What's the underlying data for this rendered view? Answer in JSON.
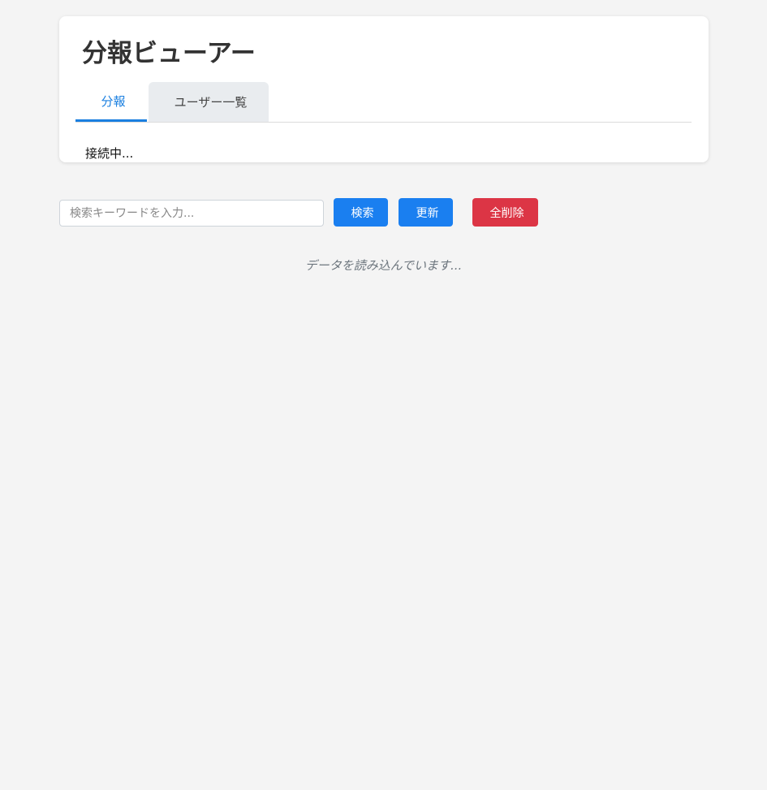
{
  "app": {
    "title_icon_glyph": "",
    "title": "分報ビューアー"
  },
  "tabs": [
    {
      "icon_glyph": "",
      "label": "分報",
      "active": true
    },
    {
      "icon_glyph": "",
      "label": "ユーザー一覧",
      "active": false
    }
  ],
  "status_text": "接続中...",
  "search": {
    "placeholder": "検索キーワードを入力...",
    "value": ""
  },
  "buttons": {
    "search": {
      "icon_glyph": "",
      "label": "検索"
    },
    "refresh": {
      "icon_glyph": "",
      "label": "更新"
    },
    "delete_all": {
      "icon_glyph": "",
      "label": "全削除"
    }
  },
  "loading_text": "データを読み込んでいます...",
  "colors": {
    "accent": "#1a7fe0",
    "danger": "#dc3545",
    "background": "#f4f4f4"
  },
  "icons": {
    "title": "chat-icon",
    "tab_feed": "message-icon",
    "tab_users": "users-icon",
    "search": "search-icon",
    "refresh": "refresh-icon",
    "delete": "trash-icon"
  }
}
